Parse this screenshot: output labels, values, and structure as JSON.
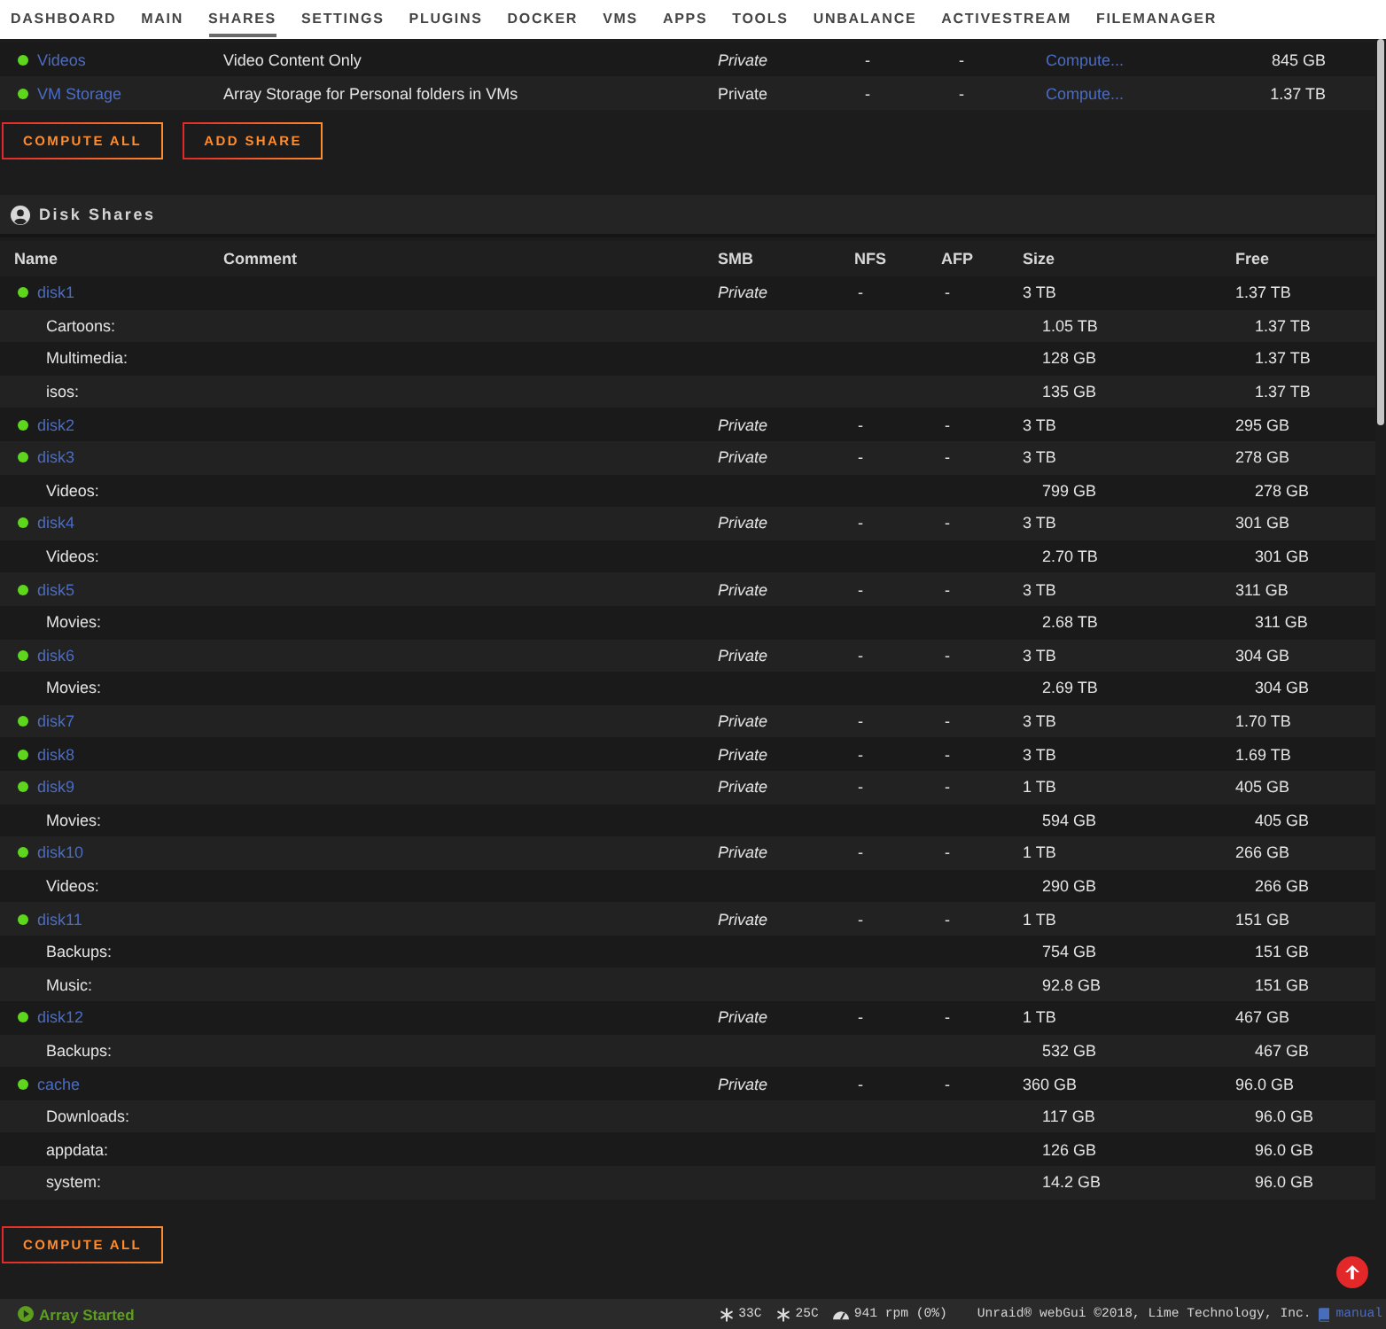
{
  "nav": {
    "items": [
      {
        "label": "DASHBOARD",
        "selected": false
      },
      {
        "label": "MAIN",
        "selected": false
      },
      {
        "label": "SHARES",
        "selected": true
      },
      {
        "label": "SETTINGS",
        "selected": false
      },
      {
        "label": "PLUGINS",
        "selected": false
      },
      {
        "label": "DOCKER",
        "selected": false
      },
      {
        "label": "VMS",
        "selected": false
      },
      {
        "label": "APPS",
        "selected": false
      },
      {
        "label": "TOOLS",
        "selected": false
      },
      {
        "label": "UNBALANCE",
        "selected": false
      },
      {
        "label": "ACTIVESTREAM",
        "selected": false
      },
      {
        "label": "FILEMANAGER",
        "selected": false
      }
    ]
  },
  "user_shares": {
    "rows": [
      {
        "name": "Videos",
        "comment": "Video Content Only",
        "smb": "Private",
        "smb_italic": true,
        "nfs": "-",
        "afp": "-",
        "size": "Compute...",
        "free": "845 GB"
      },
      {
        "name": "VM Storage",
        "comment": "Array Storage for Personal folders in VMs",
        "smb": "Private",
        "smb_italic": false,
        "nfs": "-",
        "afp": "-",
        "size": "Compute...",
        "free": "1.37 TB"
      }
    ],
    "buttons": [
      "COMPUTE ALL",
      "ADD SHARE"
    ]
  },
  "disk_shares": {
    "title": "Disk Shares",
    "columns": [
      "Name",
      "Comment",
      "SMB",
      "NFS",
      "AFP",
      "Size",
      "Free"
    ],
    "rows": [
      {
        "name": "disk1",
        "smb": "Private",
        "nfs": "-",
        "afp": "-",
        "size": "3 TB",
        "free": "1.37 TB",
        "children": [
          {
            "name": "Cartoons:",
            "size": "1.05 TB",
            "free": "1.37 TB"
          },
          {
            "name": "Multimedia:",
            "size": "128 GB",
            "free": "1.37 TB"
          },
          {
            "name": "isos:",
            "size": "135 GB",
            "free": "1.37 TB"
          }
        ]
      },
      {
        "name": "disk2",
        "smb": "Private",
        "nfs": "-",
        "afp": "-",
        "size": "3 TB",
        "free": "295 GB"
      },
      {
        "name": "disk3",
        "smb": "Private",
        "nfs": "-",
        "afp": "-",
        "size": "3 TB",
        "free": "278 GB",
        "children": [
          {
            "name": "Videos:",
            "size": "799 GB",
            "free": "278 GB"
          }
        ]
      },
      {
        "name": "disk4",
        "smb": "Private",
        "nfs": "-",
        "afp": "-",
        "size": "3 TB",
        "free": "301 GB",
        "children": [
          {
            "name": "Videos:",
            "size": "2.70 TB",
            "free": "301 GB"
          }
        ]
      },
      {
        "name": "disk5",
        "smb": "Private",
        "nfs": "-",
        "afp": "-",
        "size": "3 TB",
        "free": "311 GB",
        "children": [
          {
            "name": "Movies:",
            "size": "2.68 TB",
            "free": "311 GB"
          }
        ]
      },
      {
        "name": "disk6",
        "smb": "Private",
        "nfs": "-",
        "afp": "-",
        "size": "3 TB",
        "free": "304 GB",
        "children": [
          {
            "name": "Movies:",
            "size": "2.69 TB",
            "free": "304 GB"
          }
        ]
      },
      {
        "name": "disk7",
        "smb": "Private",
        "nfs": "-",
        "afp": "-",
        "size": "3 TB",
        "free": "1.70 TB"
      },
      {
        "name": "disk8",
        "smb": "Private",
        "nfs": "-",
        "afp": "-",
        "size": "3 TB",
        "free": "1.69 TB"
      },
      {
        "name": "disk9",
        "smb": "Private",
        "nfs": "-",
        "afp": "-",
        "size": "1 TB",
        "free": "405 GB",
        "children": [
          {
            "name": "Movies:",
            "size": "594 GB",
            "free": "405 GB"
          }
        ]
      },
      {
        "name": "disk10",
        "smb": "Private",
        "nfs": "-",
        "afp": "-",
        "size": "1 TB",
        "free": "266 GB",
        "children": [
          {
            "name": "Videos:",
            "size": "290 GB",
            "free": "266 GB"
          }
        ]
      },
      {
        "name": "disk11",
        "smb": "Private",
        "nfs": "-",
        "afp": "-",
        "size": "1 TB",
        "free": "151 GB",
        "children": [
          {
            "name": "Backups:",
            "size": "754 GB",
            "free": "151 GB"
          },
          {
            "name": "Music:",
            "size": "92.8 GB",
            "free": "151 GB"
          }
        ]
      },
      {
        "name": "disk12",
        "smb": "Private",
        "nfs": "-",
        "afp": "-",
        "size": "1 TB",
        "free": "467 GB",
        "children": [
          {
            "name": "Backups:",
            "size": "532 GB",
            "free": "467 GB"
          }
        ]
      },
      {
        "name": "cache",
        "smb": "Private",
        "nfs": "-",
        "afp": "-",
        "size": "360 GB",
        "free": "96.0 GB",
        "children": [
          {
            "name": "Downloads:",
            "size": "117 GB",
            "free": "96.0 GB"
          },
          {
            "name": "appdata:",
            "size": "126 GB",
            "free": "96.0 GB"
          },
          {
            "name": "system:",
            "size": "14.2 GB",
            "free": "96.0 GB"
          }
        ]
      }
    ],
    "buttons": [
      "COMPUTE ALL"
    ]
  },
  "status_bar": {
    "array_status": "Array Started",
    "temperatures": [
      "33C",
      "25C"
    ],
    "fan_speed": "941 rpm (0%)",
    "copyright": "Unraid® webGui ©2018, Lime Technology, Inc.",
    "manual_link": "manual"
  }
}
